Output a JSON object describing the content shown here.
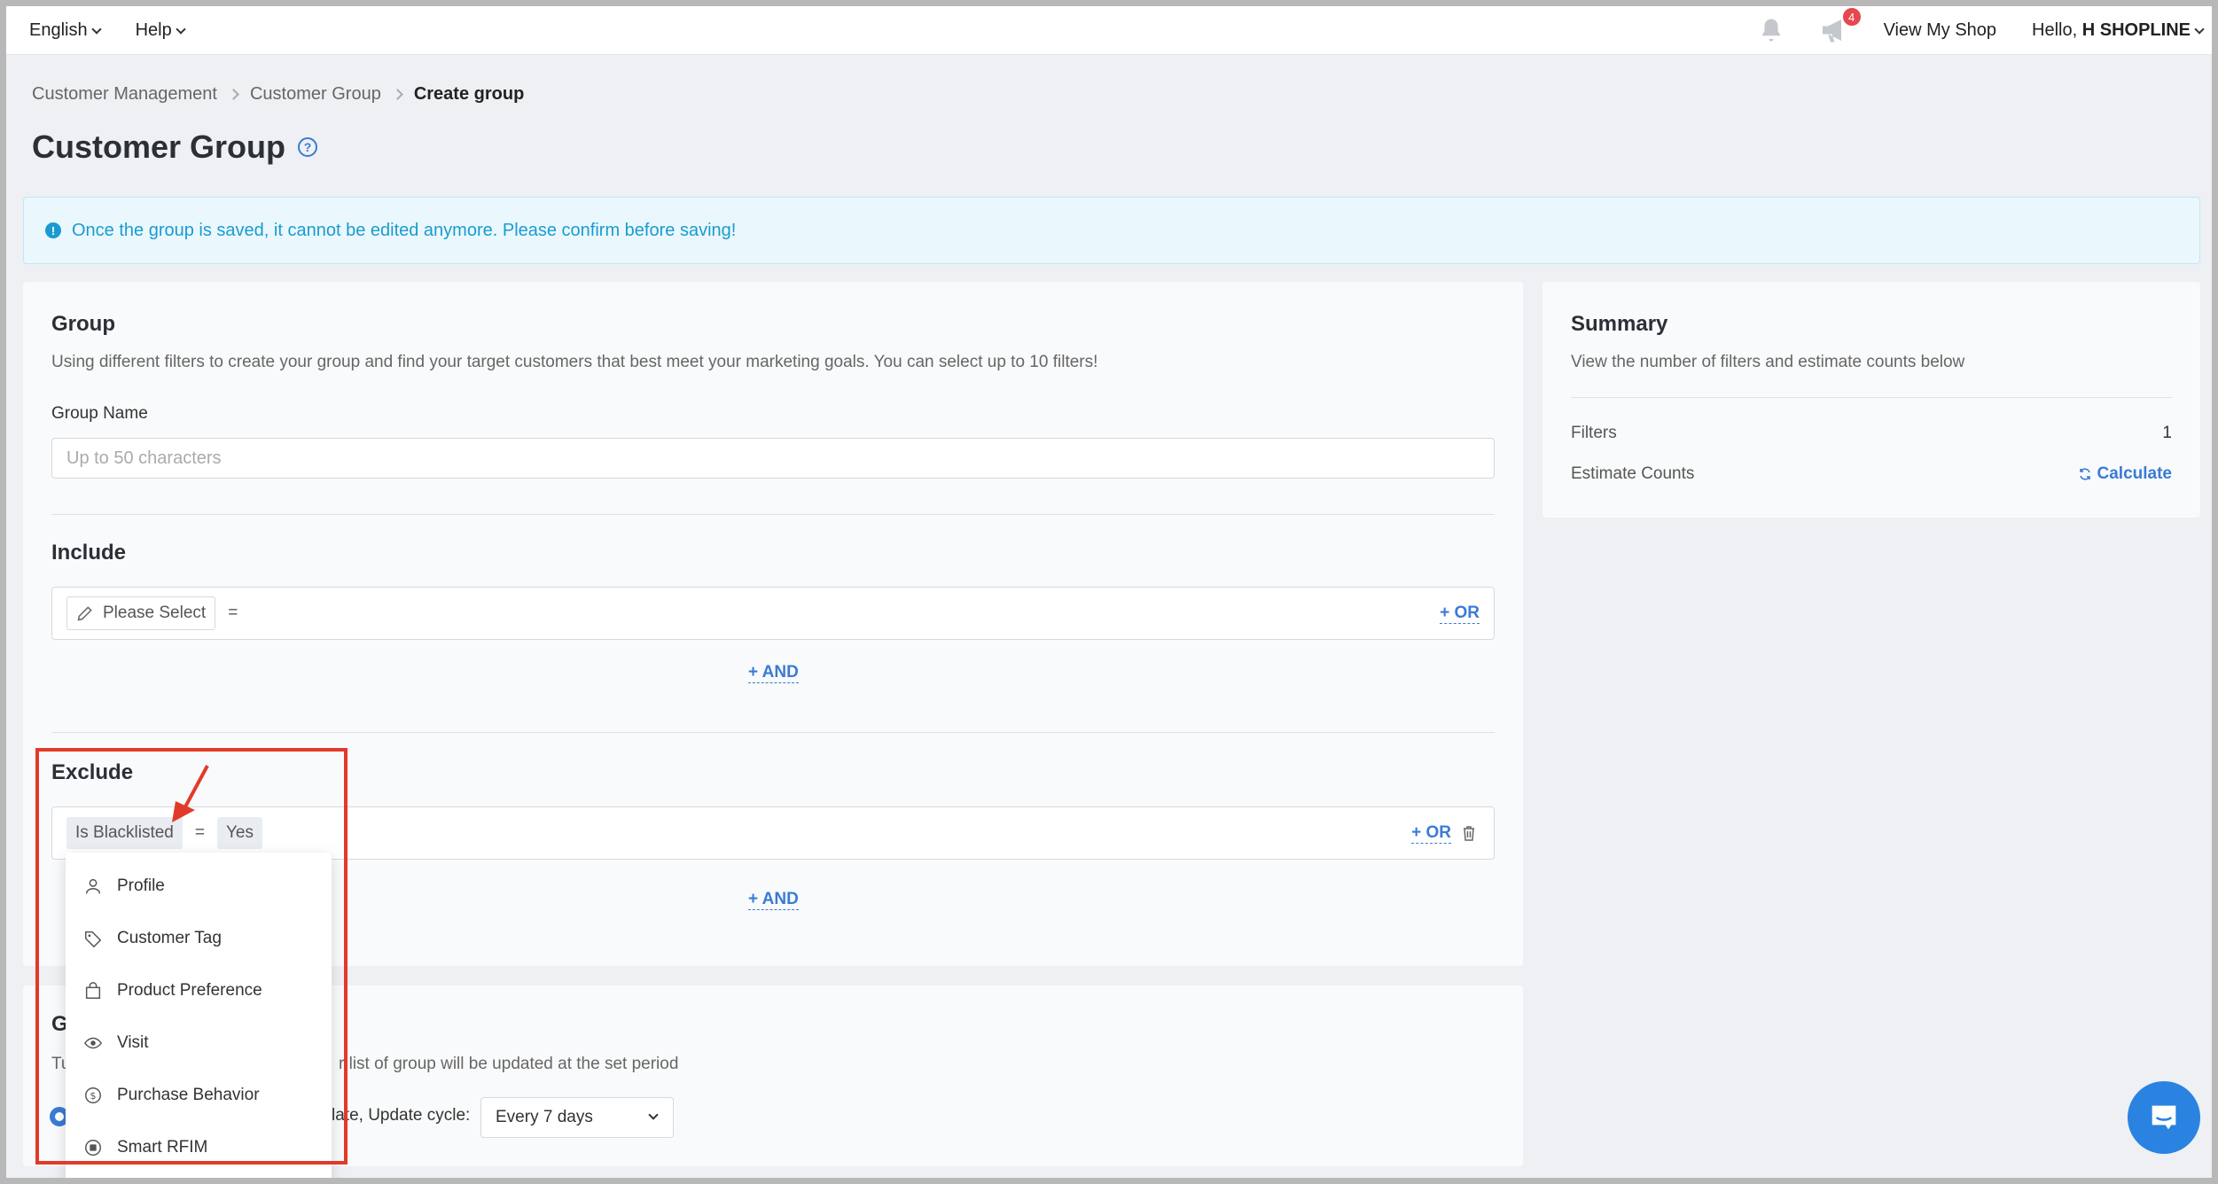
{
  "topbar": {
    "language": "English",
    "help": "Help",
    "notification_count": "4",
    "view_shop": "View My Shop",
    "hello_prefix": "Hello,",
    "user": "H SHOPLINE"
  },
  "breadcrumb": [
    "Customer Management",
    "Customer Group",
    "Create group"
  ],
  "page_title": "Customer Group",
  "notice": "Once the group is saved, it cannot be edited anymore. Please confirm before saving!",
  "group": {
    "title": "Group",
    "description": "Using different filters to create your group and find your target customers that best meet your marketing goals. You can select up to 10 filters!",
    "name_label": "Group Name",
    "name_placeholder": "Up to 50 characters"
  },
  "include": {
    "title": "Include",
    "field": "Please Select",
    "operator": "=",
    "or_label": "+ OR",
    "and_label": "+ AND"
  },
  "exclude": {
    "title": "Exclude",
    "field": "Is Blacklisted",
    "operator": "=",
    "value": "Yes",
    "or_label": "+ OR",
    "and_label": "+ AND"
  },
  "dropdown": {
    "items": [
      {
        "label": "Profile",
        "icon": "user-icon"
      },
      {
        "label": "Customer Tag",
        "icon": "tag-icon"
      },
      {
        "label": "Product Preference",
        "icon": "bag-icon"
      },
      {
        "label": "Visit",
        "icon": "eye-icon"
      },
      {
        "label": "Purchase Behavior",
        "icon": "dollar-icon"
      },
      {
        "label": "Smart RFIM",
        "icon": "rfim-icon"
      }
    ]
  },
  "cycle": {
    "title_visible": "G",
    "desc_left": "Tu",
    "desc_right": "r list of group will be updated at the set period",
    "option_right": "late, Update cycle:",
    "cycle_value": "Every 7 days"
  },
  "summary": {
    "title": "Summary",
    "description": "View the number of filters and estimate counts below",
    "filters_label": "Filters",
    "filters_value": "1",
    "estimate_label": "Estimate Counts",
    "calculate_label": "Calculate"
  },
  "colors": {
    "accent": "#3a7bd5",
    "notice_text": "#1a9bd0",
    "highlight": "#e23a2a",
    "badge": "#e5484d"
  }
}
